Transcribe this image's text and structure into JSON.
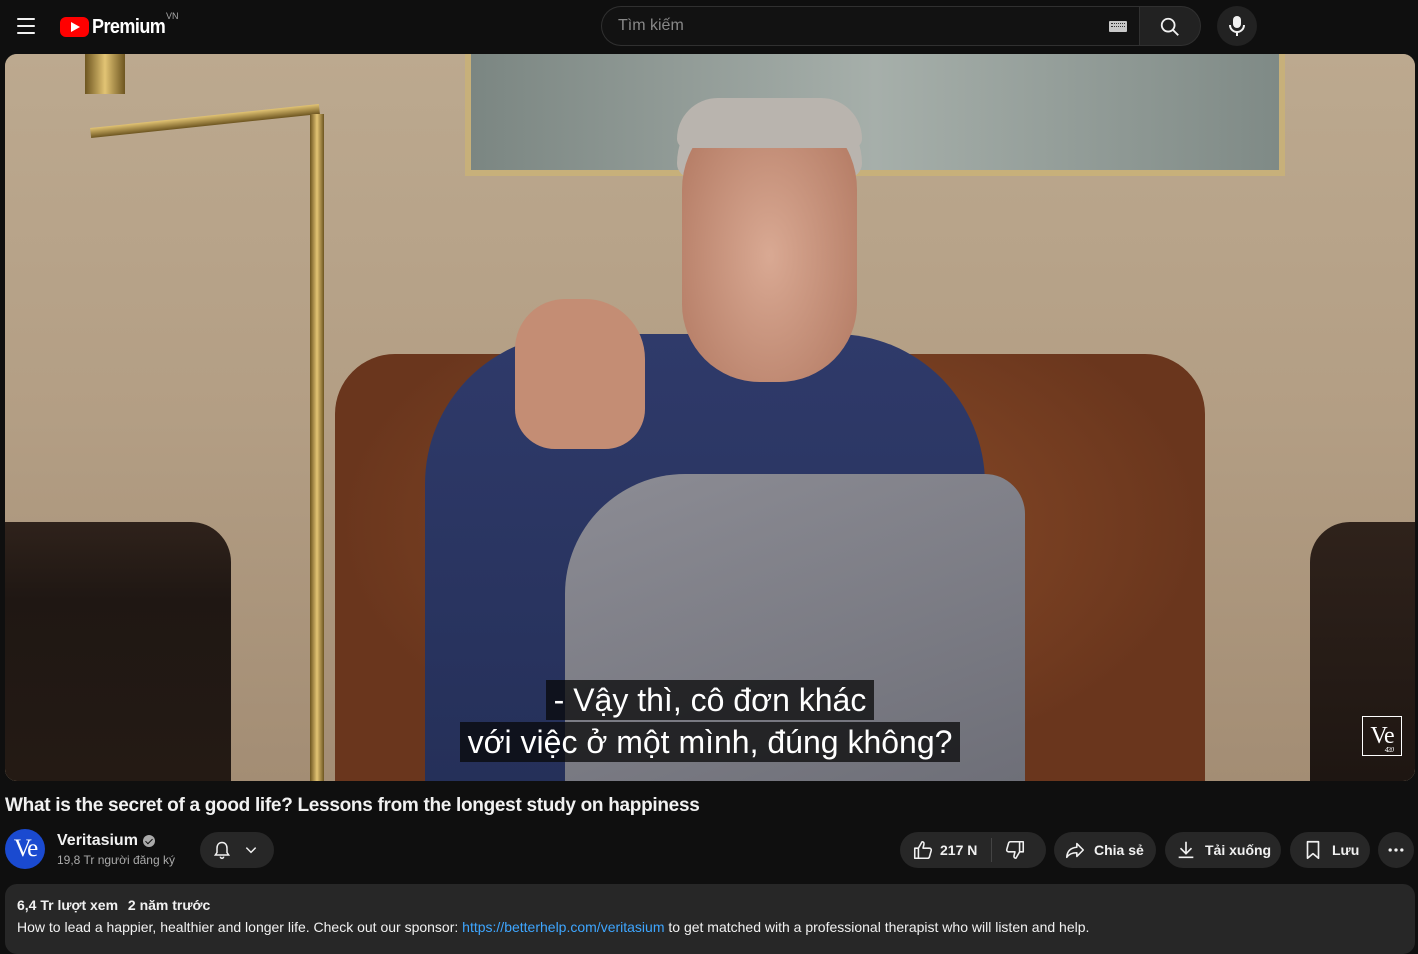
{
  "header": {
    "logo_text": "Premium",
    "country_code": "VN",
    "search_placeholder": "Tìm kiếm"
  },
  "player": {
    "subtitle_line1": "- Vậy thì, cô đơn khác",
    "subtitle_line2": "với việc ở một mình, đúng không?",
    "watermark": "Ve",
    "watermark_small": "42.0"
  },
  "video": {
    "title": "What is the secret of a good life? Lessons from the longest study on happiness"
  },
  "channel": {
    "avatar_text": "Ve",
    "name": "Veritasium",
    "subscribers": "19,8 Tr người đăng ký"
  },
  "actions": {
    "likes": "217 N",
    "share": "Chia sẻ",
    "download": "Tải xuống",
    "save": "Lưu"
  },
  "description": {
    "views": "6,4 Tr lượt xem",
    "age": "2 năm trước",
    "text_before_link": "How to lead a happier, healthier and longer life. Check out our sponsor: ",
    "link": "https://betterhelp.com/veritasium",
    "text_after_link": " to get matched with a professional therapist who will listen and help."
  },
  "colors": {
    "background": "#0f0f0f",
    "pill": "#272727",
    "brand_red": "#ff0000",
    "link": "#3ea6ff",
    "avatar": "#1a4ad0"
  }
}
